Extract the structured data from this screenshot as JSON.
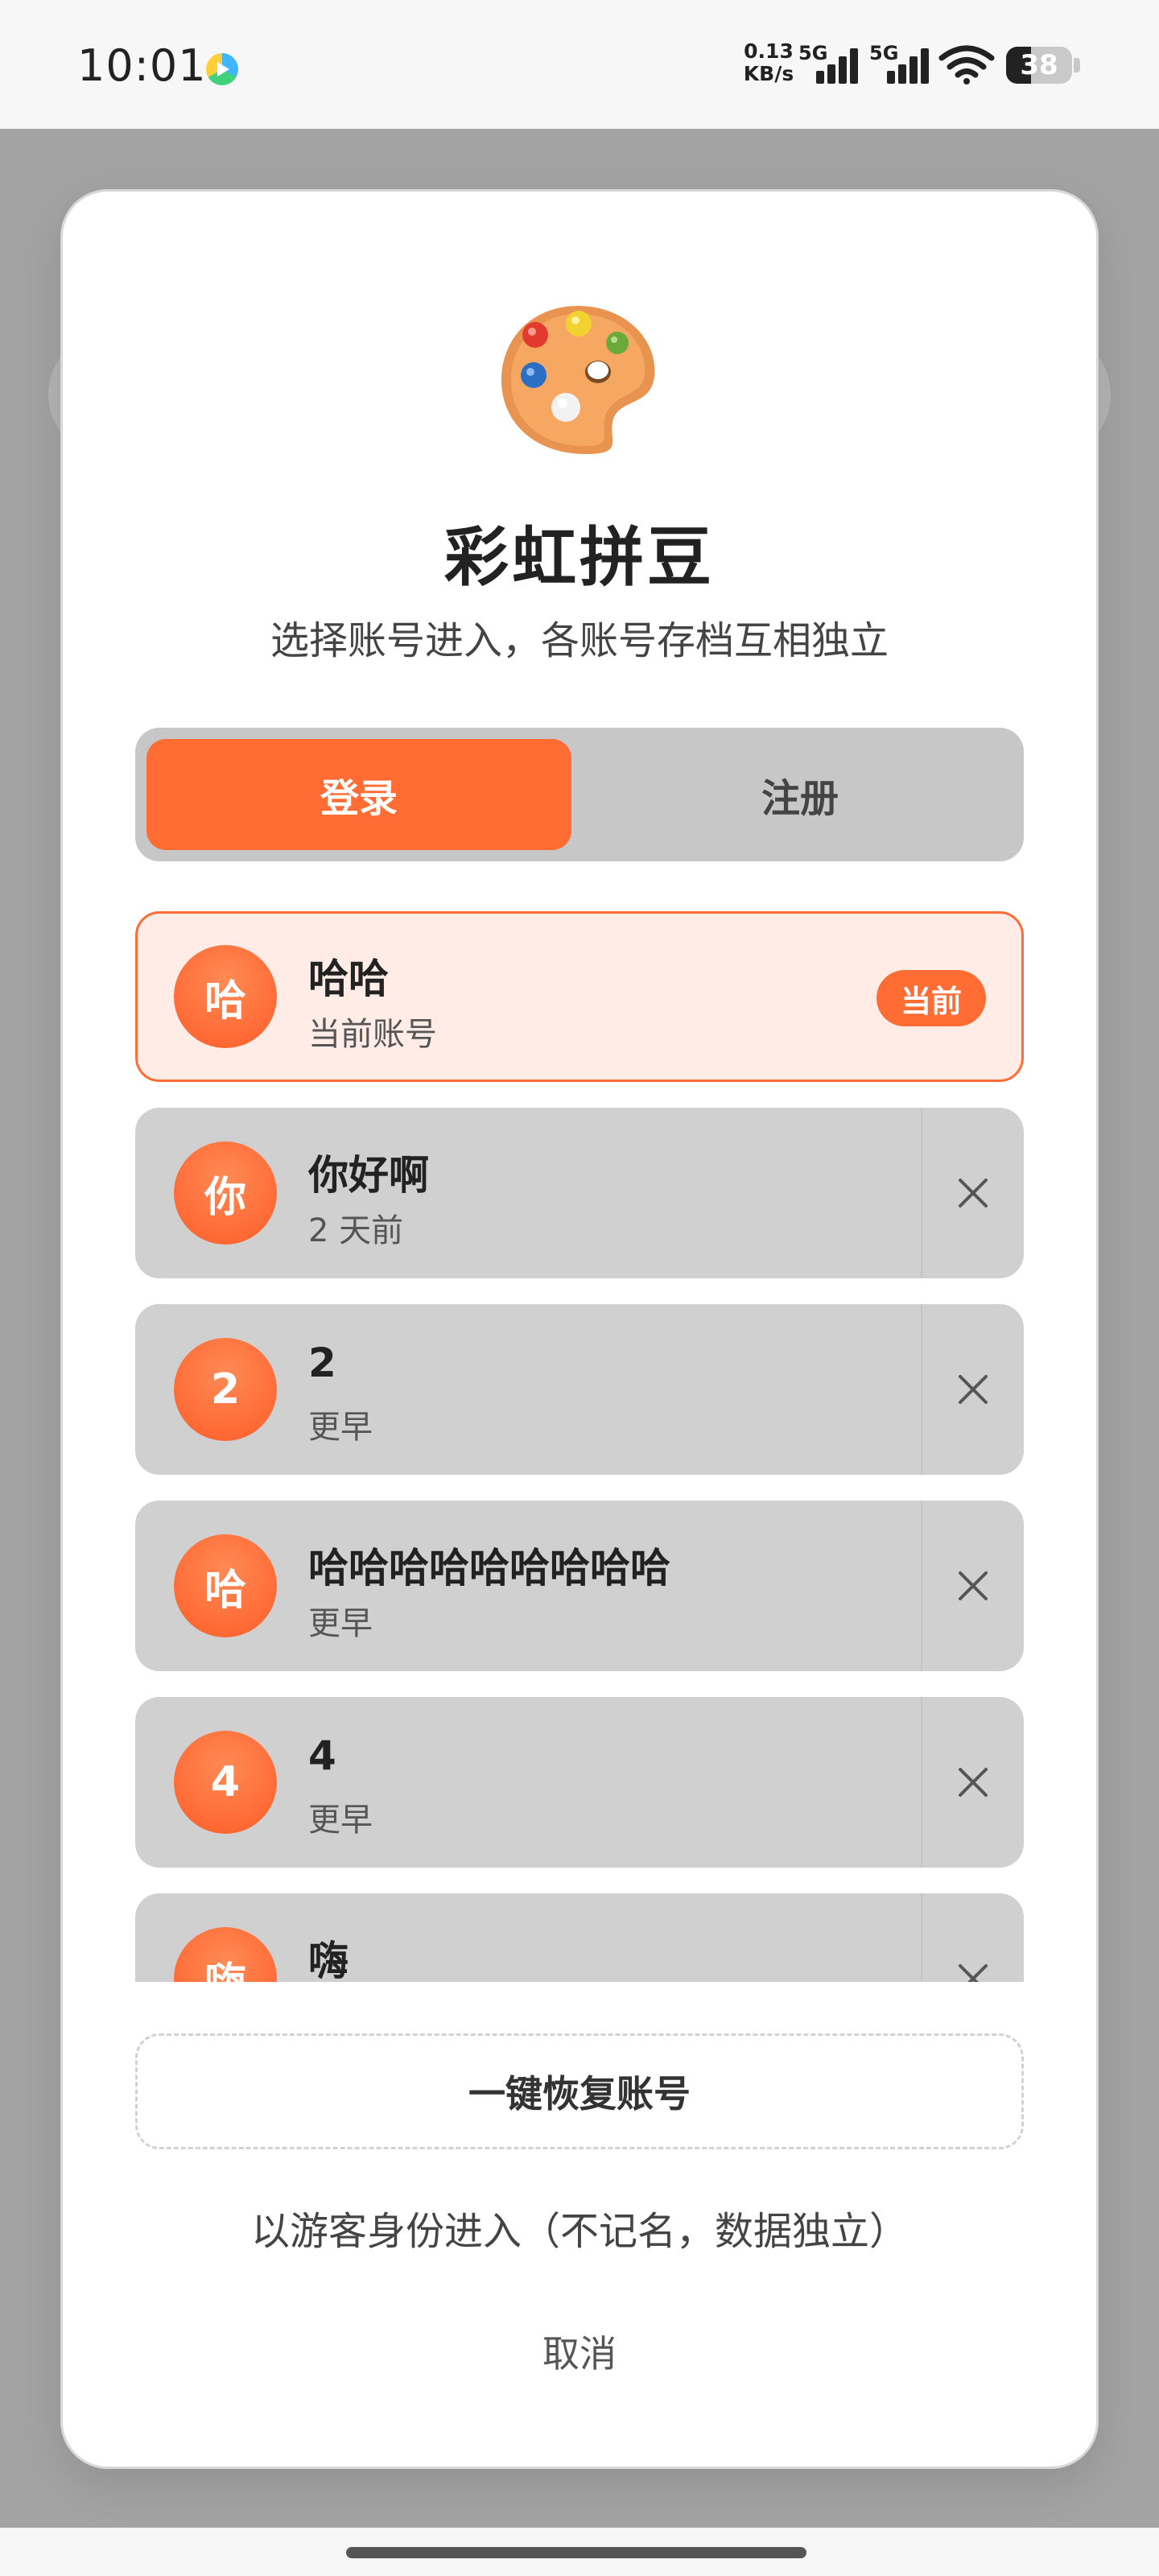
{
  "status_bar": {
    "time": "10:01",
    "net_speed_value": "0.13",
    "net_speed_unit": "KB/s",
    "signal_1_label": "5G",
    "signal_2_label": "5G",
    "battery_level": "38",
    "battery_fraction": 0.38,
    "icons": [
      "app-notification-icon",
      "signal-icon",
      "wifi-icon",
      "battery-icon"
    ]
  },
  "dialog": {
    "logo_icon": "palette-icon",
    "title": "彩虹拼豆",
    "subtitle": "选择账号进入，各账号存档互相独立",
    "tabs": {
      "login": "登录",
      "register": "注册",
      "active": "login"
    },
    "accounts": [
      {
        "avatar": "哈",
        "name": "哈哈",
        "meta": "当前账号",
        "current": true,
        "badge": "当前"
      },
      {
        "avatar": "你",
        "name": "你好啊",
        "meta": "2 天前",
        "current": false
      },
      {
        "avatar": "2",
        "name": "2",
        "meta": "更早",
        "current": false
      },
      {
        "avatar": "哈",
        "name": "哈哈哈哈哈哈哈哈哈",
        "meta": "更早",
        "current": false
      },
      {
        "avatar": "4",
        "name": "4",
        "meta": "更早",
        "current": false
      },
      {
        "avatar": "嗨",
        "name": "嗨",
        "meta": "",
        "current": false
      }
    ],
    "restore_button": "一键恢复账号",
    "guest_link": "以游客身份进入（不记名，数据独立）",
    "cancel": "取消"
  },
  "colors": {
    "accent": "#ff6d35",
    "current_bg": "#ffece6",
    "account_bg": "#d0d0d0",
    "overlay": "#a3a3a3"
  }
}
